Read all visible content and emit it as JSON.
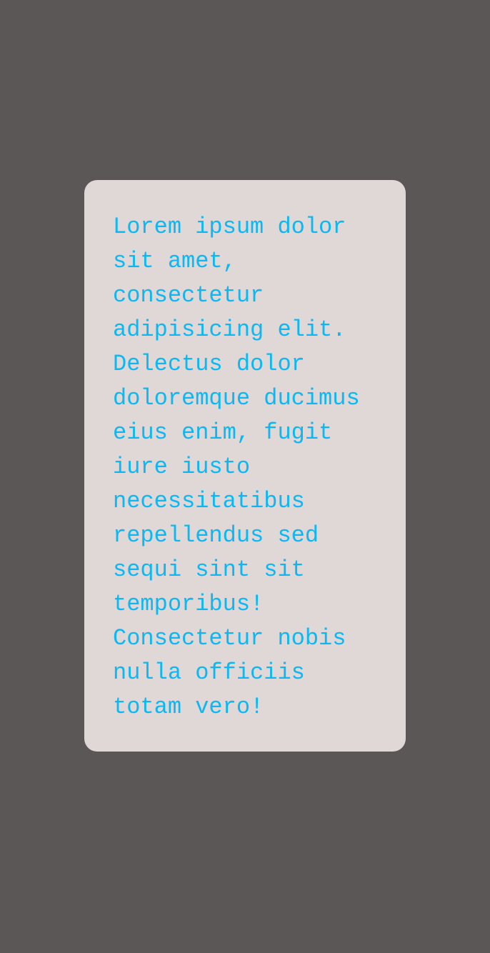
{
  "card": {
    "text": "Lorem ipsum dolor sit amet, consectetur adipisicing elit. Delectus dolor doloremque ducimus eius enim, fugit iure iusto necessitatibus repellendus sed sequi sint sit temporibus! Consectetur nobis nulla officiis totam vero!"
  },
  "colors": {
    "background": "#5b5756",
    "card_background": "#e0d7d7",
    "text": "#0bb8f5"
  }
}
